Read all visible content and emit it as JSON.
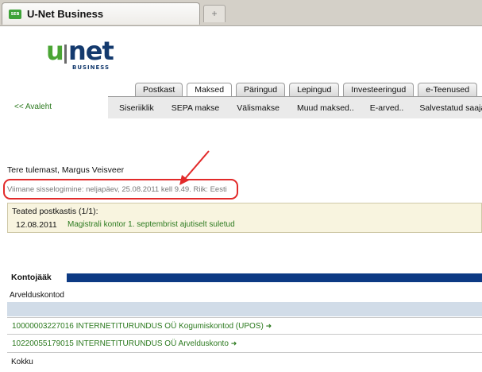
{
  "browser": {
    "favicon_text": "SEB",
    "tab_title": "U-Net Business",
    "new_tab_symbol": "+"
  },
  "logo": {
    "u": "u",
    "net": "net",
    "sub": "BUSINESS"
  },
  "main_tabs": [
    {
      "label": "Postkast",
      "active": false
    },
    {
      "label": "Maksed",
      "active": true
    },
    {
      "label": "Päringud",
      "active": false
    },
    {
      "label": "Lepingud",
      "active": false
    },
    {
      "label": "Investeeringud",
      "active": false
    },
    {
      "label": "e-Teenused",
      "active": false
    }
  ],
  "back_link": "<< Avaleht",
  "sub_nav": [
    "Siseriiklik",
    "SEPA makse",
    "Välismakse",
    "Muud maksed..",
    "E-arved..",
    "Salvestatud saajad"
  ],
  "welcome": "Tere tulemast, Margus Veisveer",
  "last_login": "Viimane sisselogimine: neljapäev, 25.08.2011 kell 9.49. Riik: Eesti",
  "notices": {
    "title": "Teated postkastis (1/1):",
    "items": [
      {
        "date": "12.08.2011",
        "text": "Magistrali kontor 1. septembrist ajutiselt suletud"
      }
    ]
  },
  "balance": {
    "title": "Kontojääk",
    "accounts_type": "Arvelduskontod",
    "accounts": [
      {
        "label": "10000003227016 INTERNETITURUNDUS OÜ Kogumiskontod (UPOS)"
      },
      {
        "label": "10220055179015 INTERNETITURUNDUS OÜ Arvelduskonto"
      }
    ],
    "go_symbol": "➜",
    "total_label": "Kokku"
  },
  "colors": {
    "accent_green": "#2c7a1f",
    "brand_blue": "#0d3a84",
    "highlight_red": "#e22a2a"
  }
}
